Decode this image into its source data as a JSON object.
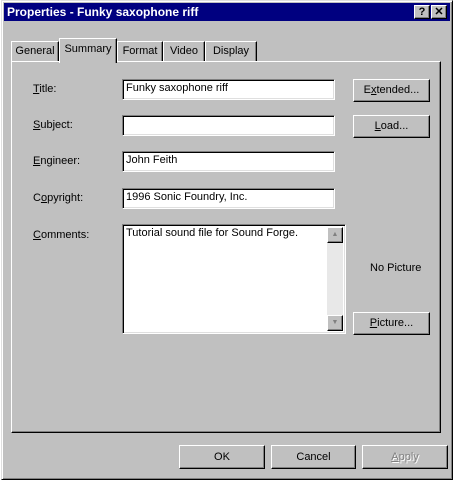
{
  "window": {
    "title": "Properties - Funky saxophone riff",
    "help_button": "?",
    "close_button": "✕"
  },
  "tabs": [
    {
      "label": "General",
      "active": false
    },
    {
      "label": "Summary",
      "active": true
    },
    {
      "label": "Format",
      "active": false
    },
    {
      "label": "Video",
      "active": false
    },
    {
      "label": "Display",
      "active": false
    }
  ],
  "form": {
    "title_label_mn": "T",
    "title_label_rest": "itle:",
    "title_value": "Funky saxophone riff",
    "subject_label_mn": "S",
    "subject_label_rest": "ubject:",
    "subject_value": "",
    "engineer_label_mn": "E",
    "engineer_label_rest": "ngineer:",
    "engineer_value": "John Feith",
    "copyright_label_pre": "C",
    "copyright_label_mn": "o",
    "copyright_label_rest": "pyright:",
    "copyright_value": "1996 Sonic Foundry, Inc.",
    "comments_label_mn": "C",
    "comments_label_rest": "omments:",
    "comments_value": "Tutorial sound file for Sound Forge."
  },
  "side": {
    "extended_pre": "E",
    "extended_mn": "x",
    "extended_rest": "tended...",
    "load_mn": "L",
    "load_rest": "oad...",
    "no_picture": "No Picture",
    "picture_mn": "P",
    "picture_rest": "icture..."
  },
  "scrollbar": {
    "up_icon": "▲",
    "down_icon": "▼"
  },
  "footer": {
    "ok": "OK",
    "cancel": "Cancel",
    "apply_mn": "A",
    "apply_rest": "pply"
  }
}
